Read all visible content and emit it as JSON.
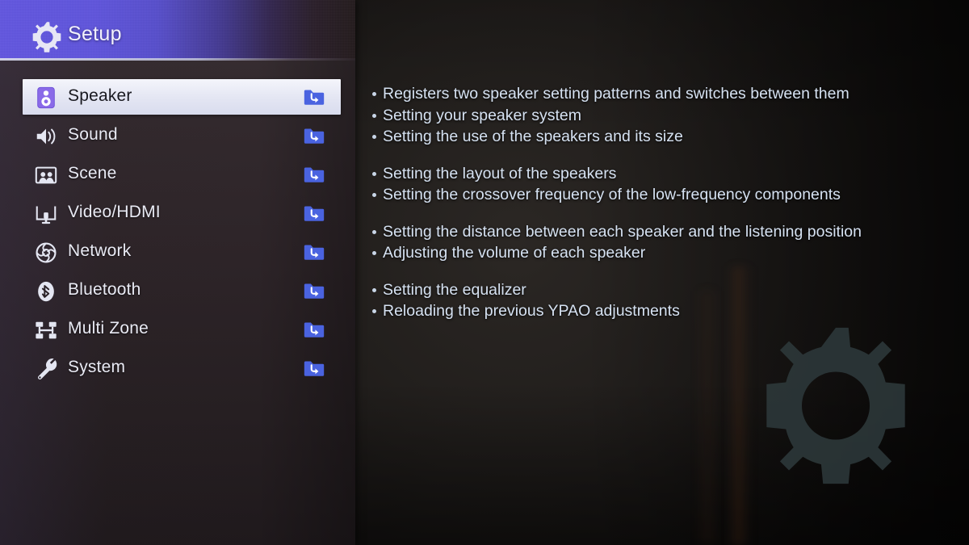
{
  "header": {
    "title": "Setup",
    "icon": "gear-icon",
    "accent_color": "#6257e0"
  },
  "theme": {
    "sidebar_bg": "#2d2428",
    "panel_bg": "#201d1b",
    "highlight_bg": "#e8eaf6",
    "enter_icon_color": "#4a63e0",
    "bullet_text_color": "#d6e2f2",
    "watermark_color": "#2d393b"
  },
  "sidebar": {
    "selected_index": 0,
    "items": [
      {
        "label": "Speaker",
        "icon": "speaker-box-icon",
        "enter_icon": "folder-enter-icon",
        "selected": true
      },
      {
        "label": "Sound",
        "icon": "loudspeaker-waves-icon",
        "enter_icon": "folder-enter-icon",
        "selected": false
      },
      {
        "label": "Scene",
        "icon": "screen-people-icon",
        "enter_icon": "folder-enter-icon",
        "selected": false
      },
      {
        "label": "Video/HDMI",
        "icon": "monitor-plug-icon",
        "enter_icon": "folder-enter-icon",
        "selected": false
      },
      {
        "label": "Network",
        "icon": "globe-icon",
        "enter_icon": "folder-enter-icon",
        "selected": false
      },
      {
        "label": "Bluetooth",
        "icon": "bluetooth-icon",
        "enter_icon": "folder-enter-icon",
        "selected": false
      },
      {
        "label": "Multi Zone",
        "icon": "multi-zone-icon",
        "enter_icon": "folder-enter-icon",
        "selected": false
      },
      {
        "label": "System",
        "icon": "wrench-icon",
        "enter_icon": "folder-enter-icon",
        "selected": false
      }
    ]
  },
  "description": {
    "groups": [
      {
        "bullets": [
          "Registers two speaker setting patterns and switches between them",
          "Setting your speaker system",
          "Setting the use of the speakers and its size"
        ]
      },
      {
        "bullets": [
          "Setting the layout of the speakers",
          "Setting the crossover frequency of the low-frequency components"
        ]
      },
      {
        "bullets": [
          "Setting the distance between each speaker and the listening position",
          "Adjusting the volume of each speaker"
        ]
      },
      {
        "bullets": [
          "Setting the equalizer",
          "Reloading the previous YPAO adjustments"
        ]
      }
    ]
  },
  "watermark": {
    "icon": "gear-icon"
  }
}
